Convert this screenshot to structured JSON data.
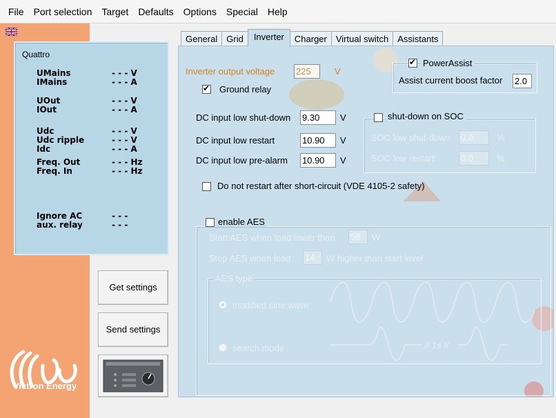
{
  "menu": [
    "File",
    "Port selection",
    "Target",
    "Defaults",
    "Options",
    "Special",
    "Help"
  ],
  "device": {
    "name": "Quattro",
    "stats": [
      {
        "label": "UMains",
        "value": "- - - V"
      },
      {
        "label": "IMains",
        "value": "- - - A"
      },
      {
        "label": "UOut",
        "value": "- - - V"
      },
      {
        "label": "IOut",
        "value": "- - - A"
      },
      {
        "label": "Udc",
        "value": "- - - V"
      },
      {
        "label": "Udc ripple",
        "value": "- - - V"
      },
      {
        "label": "Idc",
        "value": "- - - A"
      },
      {
        "label": "Freq. Out",
        "value": "- - - Hz"
      },
      {
        "label": "Freq. In",
        "value": "- - - Hz"
      },
      {
        "label": "Ignore AC",
        "value": "- - -"
      },
      {
        "label": "aux. relay",
        "value": "- - -"
      }
    ]
  },
  "buttons": {
    "get_settings": "Get settings",
    "send_settings": "Send settings"
  },
  "brand": "Victron Energy",
  "tabs": [
    "General",
    "Grid",
    "Inverter",
    "Charger",
    "Virtual switch",
    "Assistants"
  ],
  "inverter": {
    "output_voltage": {
      "label": "Inverter output voltage",
      "value": "225",
      "unit": "V"
    },
    "ground_relay": {
      "label": "Ground relay",
      "checked": true
    },
    "power_assist": {
      "label": "PowerAssist",
      "checked": true,
      "boost_label": "Assist current boost factor",
      "boost_value": "2.0"
    },
    "dc_low_shutdown": {
      "label": "DC input low shut-down",
      "value": "9.30",
      "unit": "V"
    },
    "dc_low_restart": {
      "label": "DC input low restart",
      "value": "10.90",
      "unit": "V"
    },
    "dc_low_prealarm": {
      "label": "DC input low pre-alarm",
      "value": "10.90",
      "unit": "V"
    },
    "soc": {
      "label": "shut-down on SOC",
      "checked": false,
      "low_shutdown_label": "SOC low shut-down",
      "low_shutdown_value": "0.0",
      "low_restart_label": "SOC low restart",
      "low_restart_value": "0.0",
      "unit": "%"
    },
    "no_restart": {
      "label": "Do not restart after short-circuit (VDE 4105-2  safety)",
      "checked": false
    },
    "aes": {
      "label": "enable AES",
      "checked": false,
      "start_prefix": "Start AES when load lower than",
      "start_value": "58",
      "start_unit": "W",
      "stop_prefix": "Stop AES when load",
      "stop_value": "14",
      "stop_suffix": "W  higher than start level",
      "type_label": "AES type",
      "modified_sine": "modified sine wave",
      "search_mode": "search mode",
      "interval": "// 1s //"
    }
  },
  "colors": {
    "panel_bg": "#c9e0ec",
    "left_bg": "#f4a373",
    "accent": "#d9831f"
  }
}
